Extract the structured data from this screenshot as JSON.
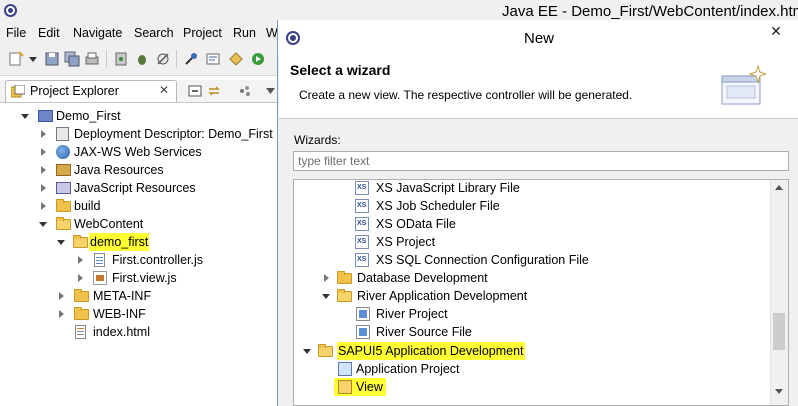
{
  "window": {
    "title": "Java EE - Demo_First/WebContent/index.htm"
  },
  "menubar": {
    "items": [
      "File",
      "Edit",
      "Navigate",
      "Search",
      "Project",
      "Run",
      "W"
    ]
  },
  "project_explorer": {
    "tab_label": "Project Explorer",
    "tree": [
      {
        "label": "Demo_First",
        "icon": "project-icon",
        "expanded": true
      },
      {
        "label": "Deployment Descriptor: Demo_First",
        "icon": "deployment-descriptor-icon"
      },
      {
        "label": "JAX-WS Web Services",
        "icon": "web-services-icon"
      },
      {
        "label": "Java Resources",
        "icon": "java-resources-icon"
      },
      {
        "label": "JavaScript Resources",
        "icon": "javascript-resources-icon"
      },
      {
        "label": "build",
        "icon": "folder-icon"
      },
      {
        "label": "WebContent",
        "icon": "folder-open-icon",
        "expanded": true
      },
      {
        "label": "demo_first",
        "icon": "folder-open-icon",
        "expanded": true,
        "highlighted": true
      },
      {
        "label": "First.controller.js",
        "icon": "js-file-icon"
      },
      {
        "label": "First.view.js",
        "icon": "js-view-file-icon"
      },
      {
        "label": "META-INF",
        "icon": "folder-icon"
      },
      {
        "label": "WEB-INF",
        "icon": "folder-icon"
      },
      {
        "label": "index.html",
        "icon": "html-file-icon"
      }
    ]
  },
  "dialog": {
    "title": "New",
    "close_label": "✕",
    "banner_title": "Select a wizard",
    "banner_description": "Create a new view. The respective controller will be generated.",
    "wizards_label": "Wizards:",
    "filter_placeholder": "type filter text",
    "wizard_items": [
      {
        "label": "XS JavaScript Library File",
        "icon": "xs-file-icon"
      },
      {
        "label": "XS Job Scheduler File",
        "icon": "xs-file-icon"
      },
      {
        "label": "XS OData File",
        "icon": "xs-file-icon"
      },
      {
        "label": "XS Project",
        "icon": "xs-project-icon"
      },
      {
        "label": "XS SQL Connection Configuration File",
        "icon": "xs-file-icon"
      },
      {
        "label": "Database Development",
        "icon": "folder-icon",
        "expanded": false
      },
      {
        "label": "River Application Development",
        "icon": "folder-icon",
        "expanded": true
      },
      {
        "label": "River Project",
        "icon": "river-project-icon"
      },
      {
        "label": "River Source File",
        "icon": "river-source-icon"
      },
      {
        "label": "SAPUI5 Application Development",
        "icon": "folder-open-icon",
        "expanded": true,
        "highlighted": true
      },
      {
        "label": "Application Project",
        "icon": "application-project-icon"
      },
      {
        "label": "View",
        "icon": "view-icon",
        "highlighted": true
      }
    ]
  },
  "colors": {
    "highlight": "#ffff33",
    "chrome": "#f0f0f0",
    "folder": "#f0c24a"
  }
}
